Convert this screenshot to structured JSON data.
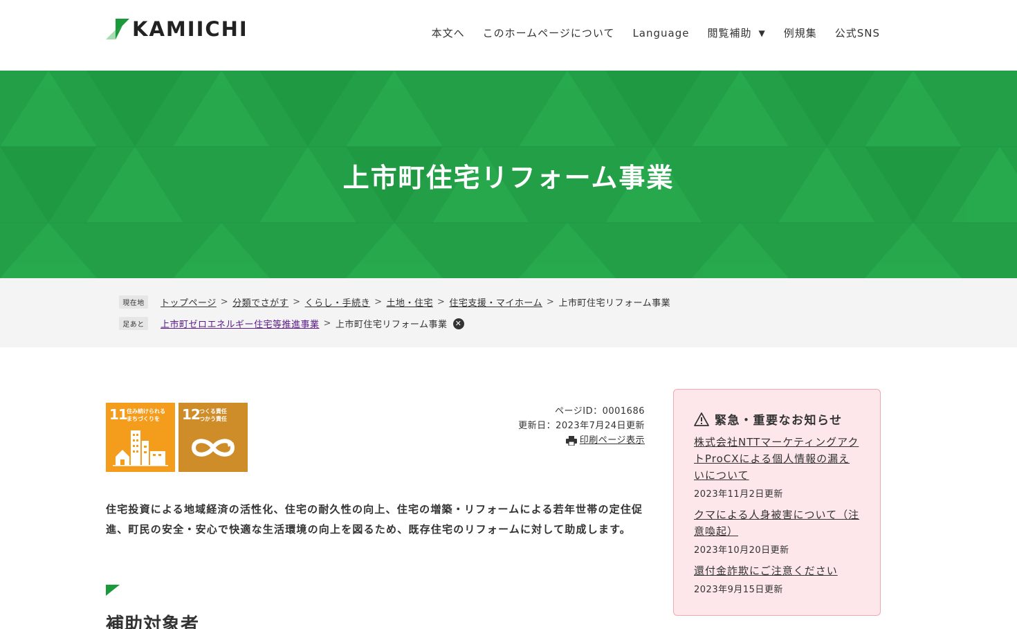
{
  "header": {
    "logo_text": "KAMIICHI",
    "nav": [
      {
        "label": "本文へ"
      },
      {
        "label": "このホームページについて"
      },
      {
        "label": "Language"
      },
      {
        "label": "閲覧補助"
      },
      {
        "label": "例規集"
      },
      {
        "label": "公式SNS"
      }
    ],
    "caret": "▼"
  },
  "hero": {
    "title": "上市町住宅リフォーム事業",
    "color": "#23a047"
  },
  "breadcrumb": {
    "current_tag": "現在地",
    "trail": [
      "トップページ",
      "分類でさがす",
      "くらし・手続き",
      "土地・住宅",
      "住宅支援・マイホーム"
    ],
    "current": "上市町住宅リフォーム事業",
    "history_tag": "足あと",
    "history_link": "上市町ゼロエネルギー住宅等推進事業",
    "history_current": "上市町住宅リフォーム事業",
    "separator": ">"
  },
  "sdgs": [
    {
      "number": "11",
      "text_line1": "住み続けられる",
      "text_line2": "まちづくりを",
      "color": "#f49c1c"
    },
    {
      "number": "12",
      "text_line1": "つくる責任",
      "text_line2": "つかう責任",
      "color": "#cf8d2a"
    }
  ],
  "meta": {
    "page_id": "ページID：0001686",
    "updated": "更新日：2023年7月24日更新",
    "print": "印刷ページ表示"
  },
  "intro": "住宅投資による地域経済の活性化、住宅の耐久性の向上、住宅の増築・リフォームによる若年世帯の定住促進、町民の安全・安心で快適な生活環境の向上を図るため、既存住宅のリフォームに対して助成します。",
  "section": {
    "title": "補助対象者"
  },
  "notice": {
    "title": "緊急・重要なお知らせ",
    "items": [
      {
        "link": "株式会社NTTマーケティングアクトProCXによる個人情報の漏えいについて",
        "date": "2023年11月2日更新"
      },
      {
        "link": "クマによる人身被害について（注意喚起）",
        "date": "2023年10月20日更新"
      },
      {
        "link": "還付金詐欺にご注意ください",
        "date": "2023年9月15日更新"
      }
    ]
  }
}
